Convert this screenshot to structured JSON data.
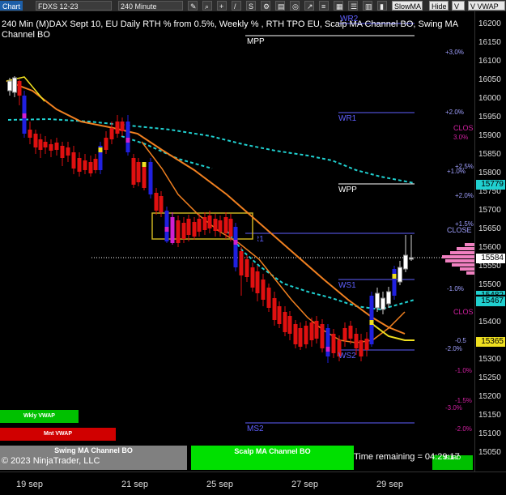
{
  "toolbar": {
    "chart_label": "Chart",
    "instrument": "FDXS 12-23",
    "interval": "240 Minute",
    "slowma": "SlowMA",
    "hide": "Hide",
    "vvwap": "V VWAP",
    "v_label": "V"
  },
  "title": "240 Min (M)DAX Sept 10, EU Daily RTH % from 0.5%, Weekly % , RTH TPO EU, Scalp MA Channel BO, Swing MA Channel BO",
  "price_scale": [
    "16200",
    "16150",
    "16100",
    "16050",
    "16000",
    "15950",
    "15900",
    "15850",
    "15800",
    "15750",
    "15700",
    "15650",
    "15600",
    "15550",
    "15500",
    "15450",
    "15400",
    "15350",
    "15300",
    "15250",
    "15200",
    "15150",
    "15100",
    "15050"
  ],
  "price_badges": {
    "cyan_top": "15779",
    "white": "15584",
    "cyan_bottom": "15467",
    "yellow": "15365",
    "partial_cyan": "15482"
  },
  "levels": {
    "wr2": "WR2",
    "mpp": "MPP",
    "wr1": "WR1",
    "wpp": "WPP",
    "ws1": "WS1",
    "ws2": "WS2",
    "ms2": "MS2",
    "r1": "R1"
  },
  "pct_labels": {
    "p3": "+3,0%",
    "p2": "+2.0%",
    "clos1": "CLOS",
    "p3b": "3.0%",
    "p25": "+2.5%",
    "p10": "+1.0%",
    "p20b": "+2.0%",
    "p15": "+1.5%",
    "close": "CLOSE",
    "m10": "-1.0%",
    "m05": "-0.5",
    "m20": "-2.0%",
    "m10b": "-1.0%",
    "m15": "-1.5%",
    "m30": "-3.0%",
    "m20b": "-2.0%",
    "clos2": "CLOS"
  },
  "buttons": {
    "wkly_vwap": "Wkly VWAP",
    "mnt_vwap": "Mnt VWAP",
    "swing": "Swing MA Channel BO",
    "scalp": "Scalp MA Channel BO"
  },
  "footer": {
    "copyright": "© 2023 NinjaTrader, LLC",
    "time_remaining": "Time remaining = 04:29:17",
    "eur_label": "EURO"
  },
  "x_axis": [
    "19 sep",
    "21 sep",
    "25 sep",
    "27 sep",
    "29 sep"
  ],
  "colors": {
    "up": "#ffffff",
    "down": "#e01010",
    "bo_blue": "#2020e0",
    "magenta": "#d020d0",
    "cyan": "#20d0d0",
    "orange": "#f08020",
    "yellow": "#f0e020",
    "level_blue": "#6060ff",
    "green_btn": "#00c000",
    "red_btn": "#d00000"
  }
}
